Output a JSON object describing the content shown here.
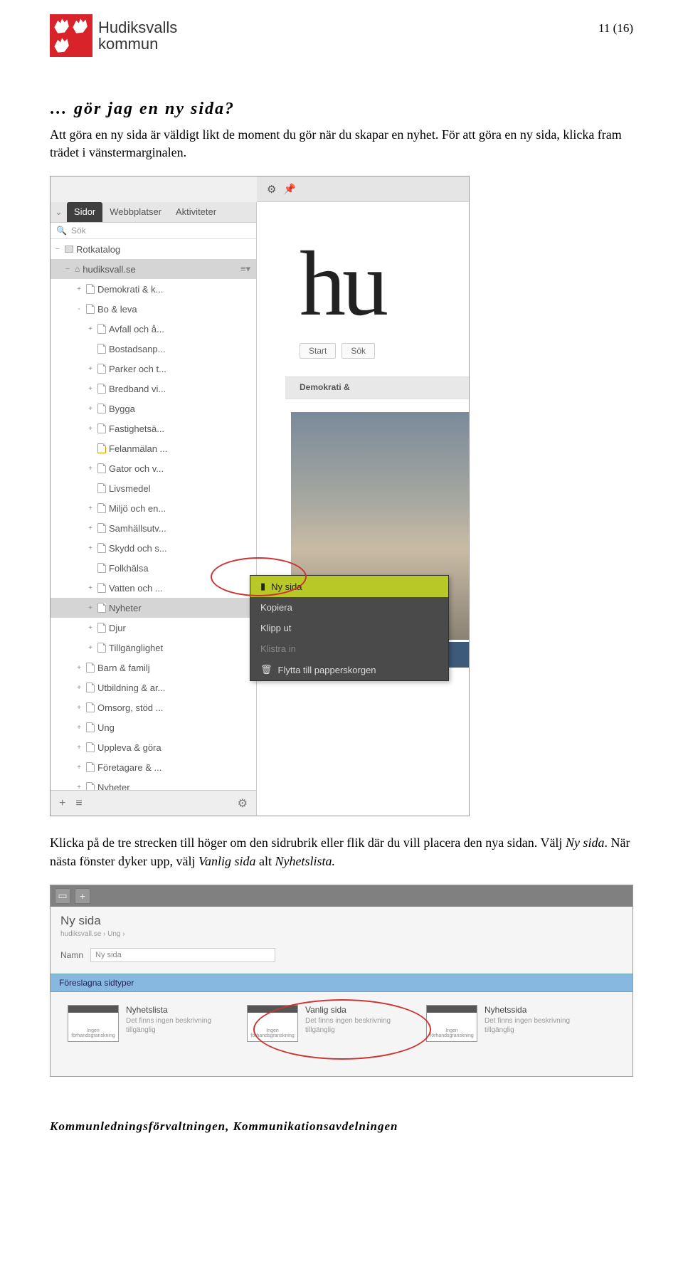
{
  "page_number": "11 (16)",
  "logo": {
    "line1": "Hudiksvalls",
    "line2": "kommun"
  },
  "heading": "… gör jag en ny sida?",
  "paragraph1": "Att göra en ny sida är väldigt likt de moment du gör när du skapar en nyhet. För att göra en ny sida, klicka fram trädet i vänstermarginalen.",
  "paragraph2_a": "Klicka på de tre strecken till höger om den sidrubrik eller flik där du vill placera den nya sidan. Välj ",
  "paragraph2_b": "Ny sida",
  "paragraph2_c": ". När nästa fönster dyker upp, välj ",
  "paragraph2_d": "Vanlig sida",
  "paragraph2_e": " alt ",
  "paragraph2_f": "Nyhetslista.",
  "footer": "Kommunledningsförvaltningen, Kommunikationsavdelningen",
  "ss1": {
    "tabs": [
      "Sidor",
      "Webbplatser",
      "Aktiviteter"
    ],
    "search_placeholder": "Sök",
    "root_label": "Rotkatalog",
    "site_label": "hudiksvall.se",
    "tree_items": [
      {
        "label": "Demokrati & k...",
        "indent": 2,
        "exp": "+"
      },
      {
        "label": "Bo & leva",
        "indent": 2,
        "exp": "-"
      },
      {
        "label": "Avfall och å...",
        "indent": 3,
        "exp": "+"
      },
      {
        "label": "Bostadsanp...",
        "indent": 3,
        "exp": ""
      },
      {
        "label": "Parker och t...",
        "indent": 3,
        "exp": "+"
      },
      {
        "label": "Bredband vi...",
        "indent": 3,
        "exp": "+"
      },
      {
        "label": "Bygga",
        "indent": 3,
        "exp": "+"
      },
      {
        "label": "Fastighetsä...",
        "indent": 3,
        "exp": "+"
      },
      {
        "label": "Felanmälan ...",
        "indent": 3,
        "exp": "",
        "flag": true
      },
      {
        "label": "Gator och v...",
        "indent": 3,
        "exp": "+"
      },
      {
        "label": "Livsmedel",
        "indent": 3,
        "exp": ""
      },
      {
        "label": "Miljö och en...",
        "indent": 3,
        "exp": "+"
      },
      {
        "label": "Samhällsutv...",
        "indent": 3,
        "exp": "+"
      },
      {
        "label": "Skydd och s...",
        "indent": 3,
        "exp": "+"
      },
      {
        "label": "Folkhälsa",
        "indent": 3,
        "exp": ""
      },
      {
        "label": "Vatten och ...",
        "indent": 3,
        "exp": "+"
      },
      {
        "label": "Nyheter",
        "indent": 3,
        "exp": "+",
        "selected": true
      },
      {
        "label": "Djur",
        "indent": 3,
        "exp": "+"
      },
      {
        "label": "Tillgänglighet",
        "indent": 3,
        "exp": "+"
      },
      {
        "label": "Barn & familj",
        "indent": 2,
        "exp": "+"
      },
      {
        "label": "Utbildning & ar...",
        "indent": 2,
        "exp": "+"
      },
      {
        "label": "Omsorg, stöd ...",
        "indent": 2,
        "exp": "+"
      },
      {
        "label": "Ung",
        "indent": 2,
        "exp": "+"
      },
      {
        "label": "Uppleva & göra",
        "indent": 2,
        "exp": "+"
      },
      {
        "label": "Företagare & ...",
        "indent": 2,
        "exp": "+"
      },
      {
        "label": "Nyheter",
        "indent": 2,
        "exp": "+"
      }
    ],
    "main_logo": "hu",
    "mini_tabs": [
      "Start",
      "Sök"
    ],
    "demo_label": "Demokrati &",
    "context_menu": {
      "items": [
        {
          "label": "Ny sida",
          "hl": true,
          "icon": "file"
        },
        {
          "label": "Kopiera"
        },
        {
          "label": "Klipp ut"
        },
        {
          "label": "Klistra in",
          "dim": true
        },
        {
          "label": "Flytta till papperskorgen",
          "icon": "trash"
        }
      ]
    }
  },
  "ss2": {
    "title": "Ny sida",
    "breadcrumb": "hudiksvall.se › Ung ›",
    "name_label": "Namn",
    "name_value": "Ny sida",
    "suggest_header": "Föreslagna sidtyper",
    "thumb_label1": "Ingen",
    "thumb_label2": "förhandsgranskning",
    "types": [
      {
        "name": "Nyhetslista",
        "desc": "Det finns ingen beskrivning tillgänglig"
      },
      {
        "name": "Vanlig sida",
        "desc": "Det finns ingen beskrivning tillgänglig"
      },
      {
        "name": "Nyhetssida",
        "desc": "Det finns ingen beskrivning tillgänglig"
      }
    ]
  }
}
